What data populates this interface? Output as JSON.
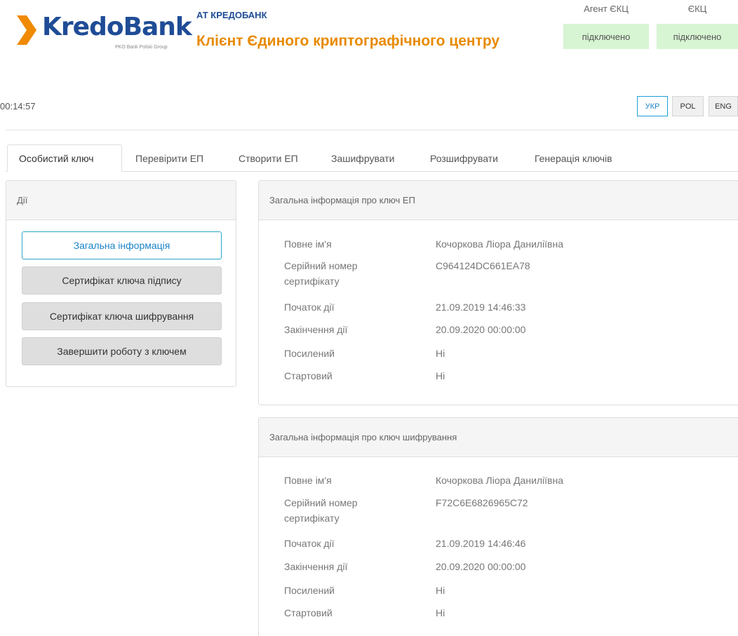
{
  "header": {
    "logo_text": "KredoBank",
    "logo_subtext": "PKO Bank Polski Group",
    "bank_name": "АТ КРЕДОБАНК",
    "app_title": "Клієнт Єдиного криптографічного центру",
    "agent_label": "Агент ЄКЦ",
    "agent_status": "підключено",
    "ekc_label": "ЄКЦ",
    "ekc_status": "підключено",
    "status_color": "#d7f5d2",
    "brand_color": "#1f4c96",
    "accent_color": "#e88a00"
  },
  "timer": "00:14:57",
  "languages": [
    {
      "label": "УКР",
      "active": true
    },
    {
      "label": "POL",
      "active": false
    },
    {
      "label": "ENG",
      "active": false
    }
  ],
  "tabs": [
    {
      "label": "Особистий ключ",
      "active": true
    },
    {
      "label": "Перевірити ЕП",
      "active": false
    },
    {
      "label": "Створити ЕП",
      "active": false
    },
    {
      "label": "Зашифрувати",
      "active": false
    },
    {
      "label": "Розшифрувати",
      "active": false
    },
    {
      "label": "Генерація ключів",
      "active": false
    }
  ],
  "actions": {
    "title": "Дії",
    "buttons": [
      {
        "label": "Загальна інформація",
        "selected": true
      },
      {
        "label": "Сертифікат ключа підпису",
        "selected": false
      },
      {
        "label": "Сертифікат ключа шифрування",
        "selected": false
      },
      {
        "label": "Завершити роботу з ключем",
        "selected": false
      }
    ]
  },
  "sign_key": {
    "title": "Загальна інформація про ключ ЕП",
    "rows": [
      {
        "label": "Повне ім'я",
        "value": "Кочоркова Ліора Даниліївна"
      },
      {
        "label": "Серійний номер сертифікату",
        "value": "C964124DC661EA78"
      },
      {
        "label": "Початок дії",
        "value": "21.09.2019 14:46:33"
      },
      {
        "label": "Закінчення дії",
        "value": "20.09.2020 00:00:00"
      },
      {
        "label": "Посилений",
        "value": "Ні"
      },
      {
        "label": "Стартовий",
        "value": "Ні"
      }
    ]
  },
  "enc_key": {
    "title": "Загальна інформація про ключ шифрування",
    "rows": [
      {
        "label": "Повне ім'я",
        "value": "Кочоркова Ліора Даниліївна"
      },
      {
        "label": "Серійний номер сертифікату",
        "value": "F72C6E6826965C72"
      },
      {
        "label": "Початок дії",
        "value": "21.09.2019 14:46:46"
      },
      {
        "label": "Закінчення дії",
        "value": "20.09.2020 00:00:00"
      },
      {
        "label": "Посилений",
        "value": "Ні"
      },
      {
        "label": "Стартовий",
        "value": "Ні"
      }
    ]
  }
}
